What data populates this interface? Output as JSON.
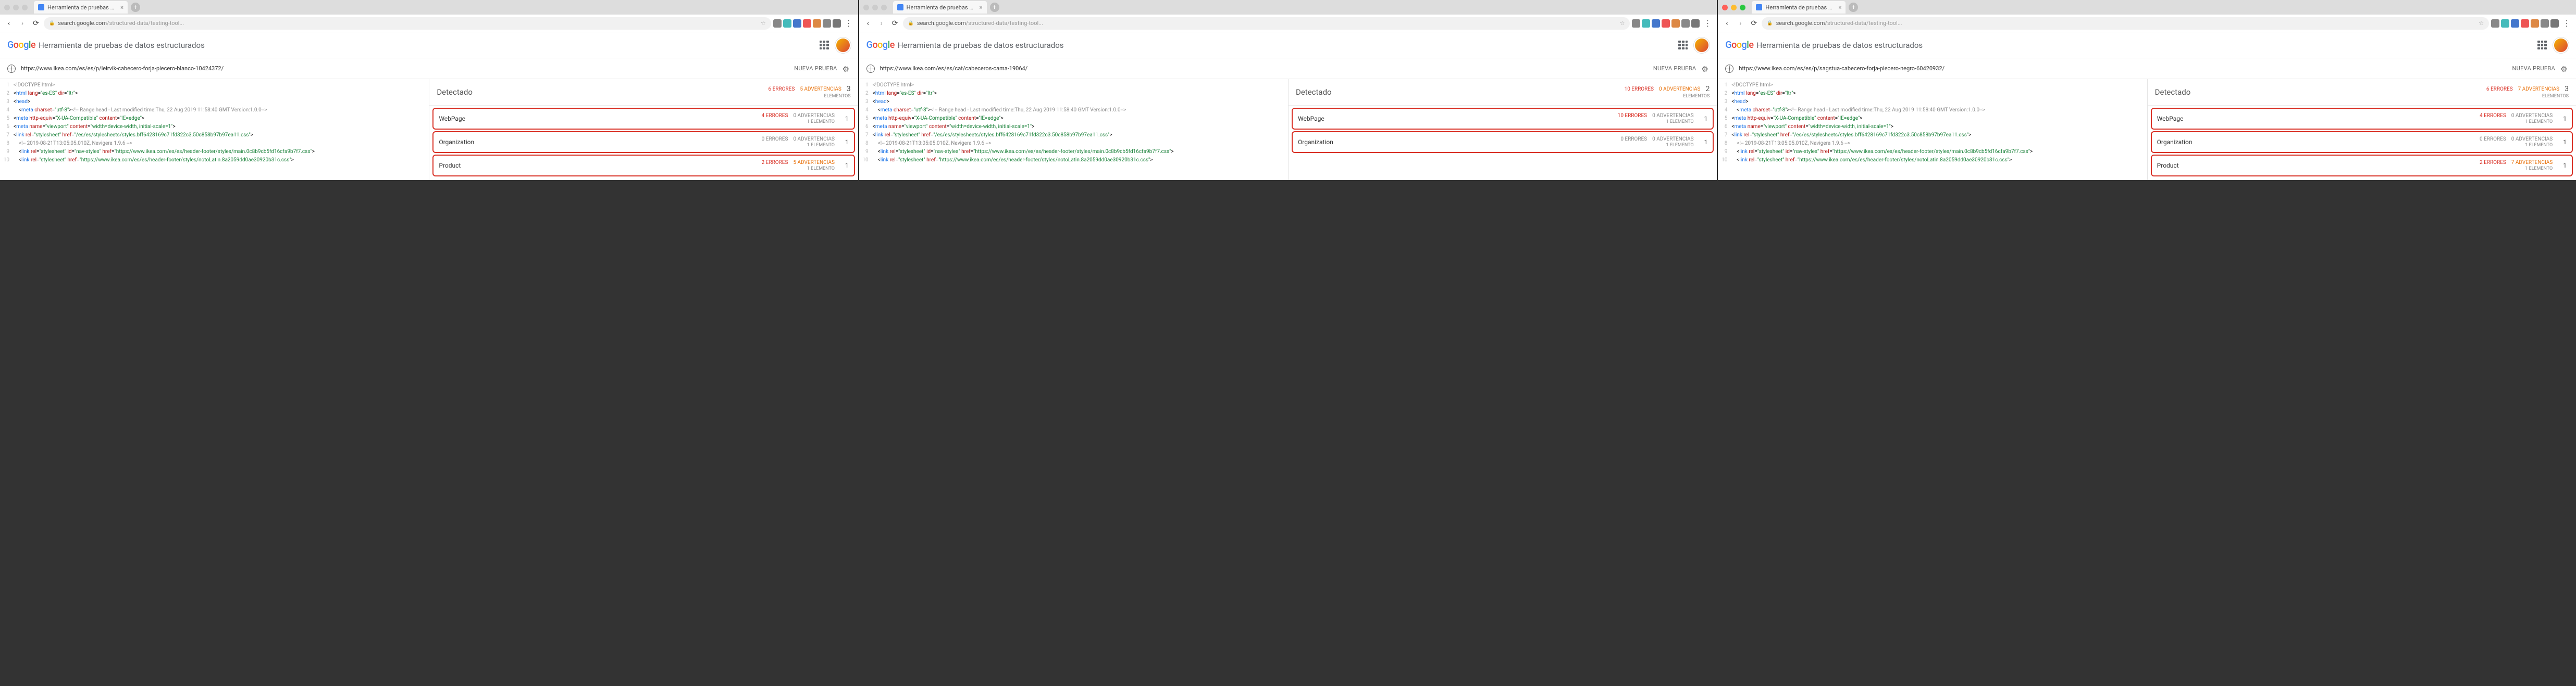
{
  "tab_title": "Herramienta de pruebas de d",
  "addr_prefix": "search.google.com",
  "addr_path": "/structured-data/testing-tool",
  "tool_title": "Herramienta de pruebas de datos estructurados",
  "new_test": "NUEVA PRUEBA",
  "detected": "Detectado",
  "elements": "ELEMENTOS",
  "element": "ELEMENTO",
  "errors_w": "ERRORES",
  "warnings_w": "ADVERTENCIAS",
  "windows": [
    {
      "traffic_colored": false,
      "tested_url": "https://www.ikea.com/es/es/p/leirvik-cabecero-forja-piecero-blanco-10424372/",
      "summary": {
        "errors": 6,
        "warnings": 5,
        "items": 3
      },
      "entities": [
        {
          "name": "WebPage",
          "errors": 4,
          "warnings": 0,
          "items": 1,
          "hl": true
        },
        {
          "name": "Organization",
          "errors": 0,
          "warnings": 0,
          "items": 1,
          "hl": true
        },
        {
          "name": "Product",
          "errors": 2,
          "warnings": 5,
          "items": 1,
          "hl": true
        }
      ]
    },
    {
      "traffic_colored": false,
      "tested_url": "https://www.ikea.com/es/es/cat/cabeceros-cama-19064/",
      "summary": {
        "errors": 10,
        "warnings": 0,
        "items": 2
      },
      "entities": [
        {
          "name": "WebPage",
          "errors": 10,
          "warnings": 0,
          "items": 1,
          "hl": true
        },
        {
          "name": "Organization",
          "errors": 0,
          "warnings": 0,
          "items": 1,
          "hl": true
        }
      ]
    },
    {
      "traffic_colored": true,
      "tested_url": "https://www.ikea.com/es/es/p/sagstua-cabecero-forja-piecero-negro-60420932/",
      "summary": {
        "errors": 6,
        "warnings": 7,
        "items": 3
      },
      "entities": [
        {
          "name": "WebPage",
          "errors": 4,
          "warnings": 0,
          "items": 1,
          "hl": true
        },
        {
          "name": "Organization",
          "errors": 0,
          "warnings": 0,
          "items": 1,
          "hl": true
        },
        {
          "name": "Product",
          "errors": 2,
          "warnings": 7,
          "items": 1,
          "hl": true
        }
      ]
    }
  ],
  "code_lines": [
    {
      "n": 1,
      "html": "<span class='t-cmt'>&lt;!DOCTYPE html&gt;</span>"
    },
    {
      "n": 2,
      "html": "&lt;<span class='t-tag'>html</span> <span class='t-attr'>lang</span>=<span class='t-val'>\"es-ES\"</span> <span class='t-attr'>dir</span>=<span class='t-val'>\"ltr\"</span>&gt;"
    },
    {
      "n": 3,
      "html": "&lt;<span class='t-tag'>head</span>&gt;"
    },
    {
      "n": 4,
      "html": "    &lt;<span class='t-tag'>meta</span> <span class='t-attr'>charset</span>=<span class='t-val'>\"utf-8\"</span>&gt;<span class='t-cmt'>&lt;!-- Range head - Last modified time:Thu, 22 Aug 2019 11:58:40 GMT Version:1.0.0--&gt;</span>"
    },
    {
      "n": 5,
      "html": "&lt;<span class='t-tag'>meta</span> <span class='t-attr'>http-equiv</span>=<span class='t-val'>\"X-UA-Compatible\"</span> <span class='t-attr'>content</span>=<span class='t-val'>\"IE=edge\"</span>&gt;"
    },
    {
      "n": 6,
      "html": "&lt;<span class='t-tag'>meta</span> <span class='t-attr'>name</span>=<span class='t-val'>\"viewport\"</span> <span class='t-attr'>content</span>=<span class='t-val'>\"width=device-width, initial-scale=1\"</span>&gt;"
    },
    {
      "n": 7,
      "html": "&lt;<span class='t-tag'>link</span> <span class='t-attr'>rel</span>=<span class='t-val'>\"stylesheet\"</span> <span class='t-attr'>href</span>=<span class='t-val'>\"/es/es/stylesheets/styles.bff6428169c71fd322c3.50c858b97b97ea11.css\"</span>&gt;"
    },
    {
      "n": 8,
      "html": "    <span class='t-cmt'>&lt;!-- 2019-08-21T13:05:05.010Z, Navigera 1.9.6 --&gt;</span>"
    },
    {
      "n": 9,
      "html": "    &lt;<span class='t-tag'>link</span> <span class='t-attr'>rel</span>=<span class='t-val'>\"stylesheet\"</span> <span class='t-attr'>id</span>=<span class='t-val'>\"nav-styles\"</span> <span class='t-attr'>href</span>=<span class='t-val'>\"https://www.ikea.com/es/es/header-footer/styles/main.0c8b9cb5fd16cfa9b7f7.css\"</span>&gt;"
    },
    {
      "n": 10,
      "html": "    &lt;<span class='t-tag'>link</span> <span class='t-attr'>rel</span>=<span class='t-val'>\"stylesheet\"</span> <span class='t-attr'>href</span>=<span class='t-val'>\"https://www.ikea.com/es/es/header-footer/styles/notoLatin.8a2059dd0ae30920b31c.css\"</span>&gt;"
    }
  ],
  "ext_colors": [
    "#888",
    "#4bb",
    "#47c",
    "#e55",
    "#d84",
    "#888",
    "#777"
  ]
}
